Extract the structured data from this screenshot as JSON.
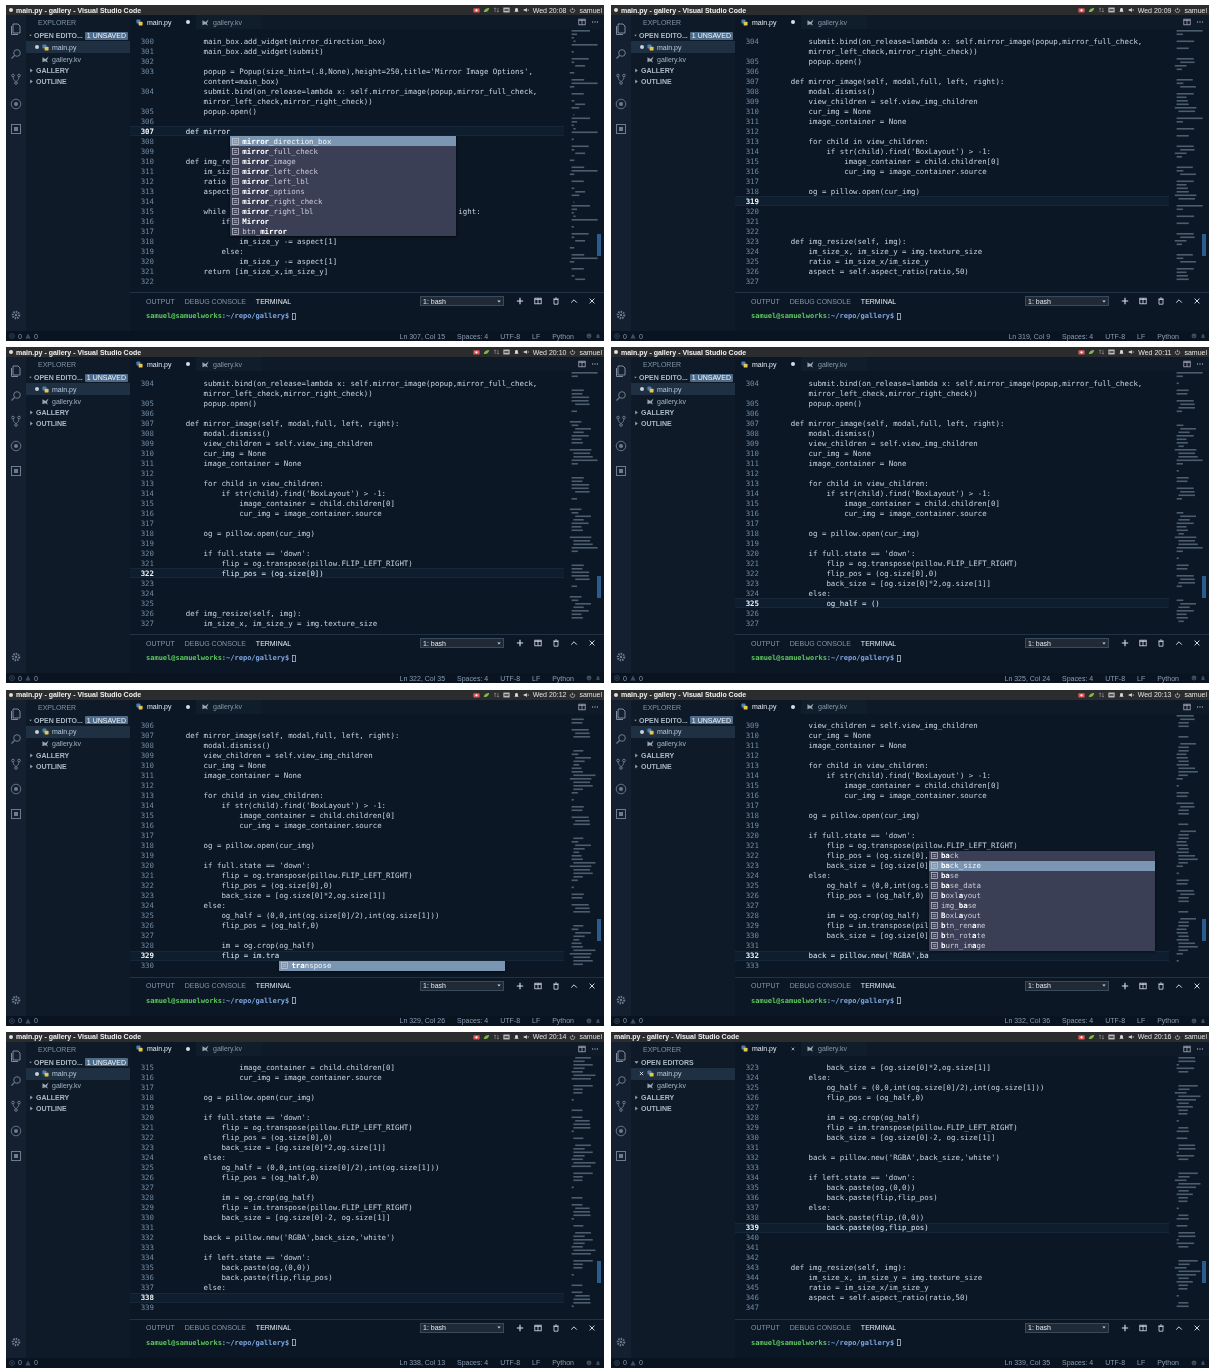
{
  "panels": [
    {
      "title": "main.py - gallery - Visual Studio Code",
      "unsaved": true,
      "clock": "Wed 20:08",
      "user": "samuel",
      "sidebar": {
        "header": "EXPLORER",
        "sections": [
          {
            "label": "OPEN EDITO...",
            "expanded": true,
            "badge": "1 UNSAVED",
            "files": [
              {
                "name": "main.py",
                "kind": "python",
                "selected": true,
                "unsaved": true
              },
              {
                "name": "gallery.kv",
                "kind": "kivy",
                "selected": false,
                "unsaved": false
              }
            ]
          },
          {
            "label": "GALLERY",
            "expanded": false
          },
          {
            "label": "OUTLINE",
            "expanded": false
          }
        ]
      },
      "tabs": [
        {
          "label": "main.py",
          "kind": "python",
          "selected": true,
          "unsaved": true
        },
        {
          "label": "gallery.kv",
          "kind": "kivy",
          "selected": false,
          "unsaved": false
        }
      ],
      "code": [
        {
          "n": "300",
          "text": "        main_box.add_widget(mirror_direction_box)",
          "current": false
        },
        {
          "n": "301",
          "text": "        main_box.add_widget(submit)",
          "current": false
        },
        {
          "n": "302",
          "current": false
        },
        {
          "n": "303",
          "text": "        popup = Popup(size_hint=(.8,None),height=250,title='Mirror Image Options',",
          "current": false
        },
        {
          "text": "        content=main_box)",
          "current": false
        },
        {
          "n": "304",
          "text": "        submit.bind(on_release=lambda x: self.mirror_image(popup,mirror_full_check,",
          "current": false
        },
        {
          "text": "        mirror_left_check,mirror_right_check))",
          "current": false
        },
        {
          "n": "305",
          "text": "        popup.open()",
          "current": false
        },
        {
          "n": "306",
          "current": false
        },
        {
          "n": "307",
          "text": "    def mirror",
          "current": true,
          "suggestions": [
            {
              "label": "**mirror**_direction_box",
              "selected": true
            },
            {
              "label": "**mirror**_full_check",
              "selected": false
            },
            {
              "label": "**mirror**_image",
              "selected": false
            },
            {
              "label": "**mirror**_left_check",
              "selected": false
            },
            {
              "label": "**mirror**_left_lbl",
              "selected": false
            },
            {
              "label": "**mirror**_options",
              "selected": false
            },
            {
              "label": "**mirror**_right_check",
              "selected": false
            },
            {
              "label": "**mirror**_right_lbl",
              "selected": false
            },
            {
              "label": "**Mirror**",
              "selected": false
            },
            {
              "label": "btn_**mirror**",
              "selected": false
            }
          ]
        },
        {
          "n": "308",
          "current": false
        },
        {
          "n": "309",
          "current": false
        },
        {
          "n": "310",
          "text": "    def img_re",
          "current": false
        },
        {
          "n": "311",
          "text": "        im_siz",
          "current": false
        },
        {
          "n": "312",
          "text": "        ratio",
          "current": false
        },
        {
          "n": "313",
          "text": "        aspect",
          "current": false
        },
        {
          "n": "314",
          "current": false
        },
        {
          "n": "315",
          "text": "        while",
          "tail": "ight:",
          "current": false
        },
        {
          "n": "316",
          "text": "            if",
          "current": false
        },
        {
          "n": "317",
          "current": false
        },
        {
          "n": "318",
          "text": "                im_size_y -= aspect[1]",
          "current": false
        },
        {
          "n": "319",
          "text": "            else:",
          "current": false
        },
        {
          "n": "320",
          "text": "                im_size_y -= aspect[1]",
          "current": false
        },
        {
          "n": "321",
          "text": "        return [im_size_x,im_size_y]",
          "current": false
        },
        {
          "n": "322",
          "current": false
        }
      ],
      "panel_tabs": [
        {
          "label": "OUTPUT",
          "selected": false
        },
        {
          "label": "DEBUG CONSOLE",
          "selected": false
        },
        {
          "label": "TERMINAL",
          "selected": true
        }
      ],
      "terminal_select": "1: bash",
      "prompt_user": "samuel@samuelworks",
      "prompt_path": ":~/repo/gallery$",
      "status": {
        "errors": "0",
        "warnings": "0",
        "items": [
          "Ln 307, Col 15",
          "Spaces: 4",
          "UTF-8",
          "LF",
          "Python"
        ]
      }
    },
    {
      "title": "main.py - gallery - Visual Studio Code",
      "unsaved": true,
      "clock": "Wed 20:09",
      "user": "samuel",
      "sidebar": {
        "header": "EXPLORER",
        "sections": [
          {
            "label": "OPEN EDITO...",
            "expanded": true,
            "badge": "1 UNSAVED",
            "files": [
              {
                "name": "main.py",
                "kind": "python",
                "selected": true,
                "unsaved": true
              },
              {
                "name": "gallery.kv",
                "kind": "kivy",
                "selected": false,
                "unsaved": false
              }
            ]
          },
          {
            "label": "GALLERY",
            "expanded": false
          },
          {
            "label": "OUTLINE",
            "expanded": false
          }
        ]
      },
      "tabs": [
        {
          "label": "main.py",
          "kind": "python",
          "selected": true,
          "unsaved": true
        },
        {
          "label": "gallery.kv",
          "kind": "kivy",
          "selected": false,
          "unsaved": false
        }
      ],
      "code": [
        {
          "n": "304",
          "text": "        submit.bind(on_release=lambda x: self.mirror_image(popup,mirror_full_check,",
          "current": false
        },
        {
          "text": "        mirror_left_check,mirror_right_check))",
          "current": false
        },
        {
          "n": "305",
          "text": "        popup.open()",
          "current": false
        },
        {
          "n": "306",
          "current": false
        },
        {
          "n": "307",
          "text": "    def mirror_image(self, modal,full, left, right):",
          "current": false
        },
        {
          "n": "308",
          "text": "        modal.dismiss()",
          "current": false
        },
        {
          "n": "309",
          "text": "        view_children = self.view_img_children",
          "current": false
        },
        {
          "n": "310",
          "text": "        cur_img = None",
          "current": false
        },
        {
          "n": "311",
          "text": "        image_container = None",
          "current": false
        },
        {
          "n": "312",
          "current": false
        },
        {
          "n": "313",
          "text": "        for child in view_children:",
          "current": false
        },
        {
          "n": "314",
          "text": "            if str(child).find('BoxLayout') > -1:",
          "current": false
        },
        {
          "n": "315",
          "text": "                image_container = child.children[0]",
          "current": false
        },
        {
          "n": "316",
          "text": "                cur_img = image_container.source",
          "current": false
        },
        {
          "n": "317",
          "current": false
        },
        {
          "n": "318",
          "text": "        og = pillow.open(cur_img)",
          "current": false
        },
        {
          "n": "319",
          "current": true
        },
        {
          "n": "320",
          "current": false
        },
        {
          "n": "321",
          "current": false
        },
        {
          "n": "322",
          "current": false
        },
        {
          "n": "323",
          "text": "    def img_resize(self, img):",
          "current": false
        },
        {
          "n": "324",
          "text": "        im_size_x, im_size_y = img.texture_size",
          "current": false
        },
        {
          "n": "325",
          "text": "        ratio = im_size_x/im_size_y",
          "current": false
        },
        {
          "n": "326",
          "text": "        aspect = self.aspect_ratio(ratio,50)",
          "current": false
        },
        {
          "n": "327",
          "current": false
        }
      ],
      "panel_tabs": [
        {
          "label": "OUTPUT",
          "selected": false
        },
        {
          "label": "DEBUG CONSOLE",
          "selected": false
        },
        {
          "label": "TERMINAL",
          "selected": true
        }
      ],
      "terminal_select": "1: bash",
      "prompt_user": "samuel@samuelworks",
      "prompt_path": ":~/repo/gallery$",
      "status": {
        "errors": "0",
        "warnings": "0",
        "items": [
          "Ln 319, Col 9",
          "Spaces: 4",
          "UTF-8",
          "LF",
          "Python"
        ]
      }
    },
    {
      "title": "main.py - gallery - Visual Studio Code",
      "unsaved": true,
      "clock": "Wed 20:10",
      "user": "samuel",
      "sidebar": {
        "header": "EXPLORER",
        "sections": [
          {
            "label": "OPEN EDITO...",
            "expanded": true,
            "badge": "1 UNSAVED",
            "files": [
              {
                "name": "main.py",
                "kind": "python",
                "selected": true,
                "unsaved": true
              },
              {
                "name": "gallery.kv",
                "kind": "kivy",
                "selected": false,
                "unsaved": false
              }
            ]
          },
          {
            "label": "GALLERY",
            "expanded": false
          },
          {
            "label": "OUTLINE",
            "expanded": false
          }
        ]
      },
      "tabs": [
        {
          "label": "main.py",
          "kind": "python",
          "selected": true,
          "unsaved": true
        },
        {
          "label": "gallery.kv",
          "kind": "kivy",
          "selected": false,
          "unsaved": false
        }
      ],
      "code": [
        {
          "n": "304",
          "text": "        submit.bind(on_release=lambda x: self.mirror_image(popup,mirror_full_check,",
          "current": false
        },
        {
          "text": "        mirror_left_check,mirror_right_check))",
          "current": false
        },
        {
          "n": "305",
          "text": "        popup.open()",
          "current": false
        },
        {
          "n": "306",
          "current": false
        },
        {
          "n": "307",
          "text": "    def mirror_image(self, modal,full, left, right):",
          "current": false
        },
        {
          "n": "308",
          "text": "        modal.dismiss()",
          "current": false
        },
        {
          "n": "309",
          "text": "        view_children = self.view_img_children",
          "current": false
        },
        {
          "n": "310",
          "text": "        cur_img = None",
          "current": false
        },
        {
          "n": "311",
          "text": "        image_container = None",
          "current": false
        },
        {
          "n": "312",
          "current": false
        },
        {
          "n": "313",
          "text": "        for child in view_children:",
          "current": false
        },
        {
          "n": "314",
          "text": "            if str(child).find('BoxLayout') > -1:",
          "current": false
        },
        {
          "n": "315",
          "text": "                image_container = child.children[0]",
          "current": false
        },
        {
          "n": "316",
          "text": "                cur_img = image_container.source",
          "current": false
        },
        {
          "n": "317",
          "current": false
        },
        {
          "n": "318",
          "text": "        og = pillow.open(cur_img)",
          "current": false
        },
        {
          "n": "319",
          "current": false
        },
        {
          "n": "320",
          "text": "        if full.state == 'down':",
          "current": false
        },
        {
          "n": "321",
          "text": "            flip = og.transpose(pillow.FLIP_LEFT_RIGHT)",
          "current": false
        },
        {
          "n": "322",
          "text": "            flip_pos = (og.size[0])",
          "current": true
        },
        {
          "n": "323",
          "current": false
        },
        {
          "n": "324",
          "current": false
        },
        {
          "n": "325",
          "current": false
        },
        {
          "n": "326",
          "text": "    def img_resize(self, img):",
          "current": false
        },
        {
          "n": "327",
          "text": "        im_size_x, im_size_y = img.texture_size",
          "current": false
        }
      ],
      "panel_tabs": [
        {
          "label": "OUTPUT",
          "selected": false
        },
        {
          "label": "DEBUG CONSOLE",
          "selected": false
        },
        {
          "label": "TERMINAL",
          "selected": true
        }
      ],
      "terminal_select": "1: bash",
      "prompt_user": "samuel@samuelworks",
      "prompt_path": ":~/repo/gallery$",
      "status": {
        "errors": "0",
        "warnings": "0",
        "items": [
          "Ln 322, Col 35",
          "Spaces: 4",
          "UTF-8",
          "LF",
          "Python"
        ]
      }
    },
    {
      "title": "main.py - gallery - Visual Studio Code",
      "unsaved": true,
      "clock": "Wed 20:11",
      "user": "samuel",
      "sidebar": {
        "header": "EXPLORER",
        "sections": [
          {
            "label": "OPEN EDITO...",
            "expanded": true,
            "badge": "1 UNSAVED",
            "files": [
              {
                "name": "main.py",
                "kind": "python",
                "selected": true,
                "unsaved": true
              },
              {
                "name": "gallery.kv",
                "kind": "kivy",
                "selected": false,
                "unsaved": false
              }
            ]
          },
          {
            "label": "GALLERY",
            "expanded": false
          },
          {
            "label": "OUTLINE",
            "expanded": false
          }
        ]
      },
      "tabs": [
        {
          "label": "main.py",
          "kind": "python",
          "selected": true,
          "unsaved": true
        },
        {
          "label": "gallery.kv",
          "kind": "kivy",
          "selected": false,
          "unsaved": false
        }
      ],
      "code": [
        {
          "n": "304",
          "text": "        submit.bind(on_release=lambda x: self.mirror_image(popup,mirror_full_check,",
          "current": false
        },
        {
          "text": "        mirror_left_check,mirror_right_check))",
          "current": false
        },
        {
          "n": "305",
          "text": "        popup.open()",
          "current": false
        },
        {
          "n": "306",
          "current": false
        },
        {
          "n": "307",
          "text": "    def mirror_image(self, modal,full, left, right):",
          "current": false
        },
        {
          "n": "308",
          "text": "        modal.dismiss()",
          "current": false
        },
        {
          "n": "309",
          "text": "        view_children = self.view_img_children",
          "current": false
        },
        {
          "n": "310",
          "text": "        cur_img = None",
          "current": false
        },
        {
          "n": "311",
          "text": "        image_container = None",
          "current": false
        },
        {
          "n": "312",
          "current": false
        },
        {
          "n": "313",
          "text": "        for child in view_children:",
          "current": false
        },
        {
          "n": "314",
          "text": "            if str(child).find('BoxLayout') > -1:",
          "current": false
        },
        {
          "n": "315",
          "text": "                image_container = child.children[0]",
          "current": false
        },
        {
          "n": "316",
          "text": "                cur_img = image_container.source",
          "current": false
        },
        {
          "n": "317",
          "current": false
        },
        {
          "n": "318",
          "text": "        og = pillow.open(cur_img)",
          "current": false
        },
        {
          "n": "319",
          "current": false
        },
        {
          "n": "320",
          "text": "        if full.state == 'down':",
          "current": false
        },
        {
          "n": "321",
          "text": "            flip = og.transpose(pillow.FLIP_LEFT_RIGHT)",
          "current": false
        },
        {
          "n": "322",
          "text": "            flip_pos = (og.size[0],0)",
          "current": false
        },
        {
          "n": "323",
          "text": "            back_size = [og.size[0]*2,og.size[1]]",
          "current": false
        },
        {
          "n": "324",
          "text": "        else:",
          "current": false
        },
        {
          "n": "325",
          "text": "            og_half = ()",
          "current": true
        },
        {
          "n": "326",
          "current": false
        },
        {
          "n": "327",
          "current": false
        }
      ],
      "panel_tabs": [
        {
          "label": "OUTPUT",
          "selected": false
        },
        {
          "label": "DEBUG CONSOLE",
          "selected": false
        },
        {
          "label": "TERMINAL",
          "selected": true
        }
      ],
      "terminal_select": "1: bash",
      "prompt_user": "samuel@samuelworks",
      "prompt_path": ":~/repo/gallery$",
      "status": {
        "errors": "0",
        "warnings": "0",
        "items": [
          "Ln 325, Col 24",
          "Spaces: 4",
          "UTF-8",
          "LF",
          "Python"
        ]
      }
    },
    {
      "title": "main.py - gallery - Visual Studio Code",
      "unsaved": true,
      "clock": "Wed 20:12",
      "user": "samuel",
      "sidebar": {
        "header": "EXPLORER",
        "sections": [
          {
            "label": "OPEN EDITO...",
            "expanded": true,
            "badge": "1 UNSAVED",
            "files": [
              {
                "name": "main.py",
                "kind": "python",
                "selected": true,
                "unsaved": true
              },
              {
                "name": "gallery.kv",
                "kind": "kivy",
                "selected": false,
                "unsaved": false
              }
            ]
          },
          {
            "label": "GALLERY",
            "expanded": false
          },
          {
            "label": "OUTLINE",
            "expanded": false
          }
        ]
      },
      "tabs": [
        {
          "label": "main.py",
          "kind": "python",
          "selected": true,
          "unsaved": true
        },
        {
          "label": "gallery.kv",
          "kind": "kivy",
          "selected": false,
          "unsaved": false
        }
      ],
      "code": [
        {
          "n": "306",
          "current": false
        },
        {
          "n": "307",
          "text": "    def mirror_image(self, modal,full, left, right):",
          "current": false
        },
        {
          "n": "308",
          "text": "        modal.dismiss()",
          "current": false
        },
        {
          "n": "309",
          "text": "        view_children = self.view_img_children",
          "current": false
        },
        {
          "n": "310",
          "text": "        cur_img = None",
          "current": false
        },
        {
          "n": "311",
          "text": "        image_container = None",
          "current": false
        },
        {
          "n": "312",
          "current": false
        },
        {
          "n": "313",
          "text": "        for child in view_children:",
          "current": false
        },
        {
          "n": "314",
          "text": "            if str(child).find('BoxLayout') > -1:",
          "current": false
        },
        {
          "n": "315",
          "text": "                image_container = child.children[0]",
          "current": false
        },
        {
          "n": "316",
          "text": "                cur_img = image_container.source",
          "current": false
        },
        {
          "n": "317",
          "current": false
        },
        {
          "n": "318",
          "text": "        og = pillow.open(cur_img)",
          "current": false
        },
        {
          "n": "319",
          "current": false
        },
        {
          "n": "320",
          "text": "        if full.state == 'down':",
          "current": false
        },
        {
          "n": "321",
          "text": "            flip = og.transpose(pillow.FLIP_LEFT_RIGHT)",
          "current": false
        },
        {
          "n": "322",
          "text": "            flip_pos = (og.size[0],0)",
          "current": false
        },
        {
          "n": "323",
          "text": "            back_size = [og.size[0]*2,og.size[1]]",
          "current": false
        },
        {
          "n": "324",
          "text": "        else:",
          "current": false
        },
        {
          "n": "325",
          "text": "            og_half = (0,0,int(og.size[0]/2),int(og.size[1]))",
          "current": false
        },
        {
          "n": "326",
          "text": "            flip_pos = (og_half,0)",
          "current": false
        },
        {
          "n": "327",
          "current": false
        },
        {
          "n": "328",
          "text": "            im = og.crop(og_half)",
          "current": false
        },
        {
          "n": "329",
          "text": "            flip = im.tra",
          "current": true,
          "suggestions": [
            {
              "label": "**tra**nspose",
              "selected": true
            }
          ]
        },
        {
          "n": "330",
          "current": false
        }
      ],
      "panel_tabs": [
        {
          "label": "OUTPUT",
          "selected": false
        },
        {
          "label": "DEBUG CONSOLE",
          "selected": false
        },
        {
          "label": "TERMINAL",
          "selected": true
        }
      ],
      "terminal_select": "1: bash",
      "prompt_user": "samuel@samuelworks",
      "prompt_path": ":~/repo/gallery$",
      "status": {
        "errors": "0",
        "warnings": "0",
        "items": [
          "Ln 329, Col 26",
          "Spaces: 4",
          "UTF-8",
          "LF",
          "Python"
        ]
      }
    },
    {
      "title": "main.py - gallery - Visual Studio Code",
      "unsaved": true,
      "clock": "Wed 20:13",
      "user": "samuel",
      "sidebar": {
        "header": "EXPLORER",
        "sections": [
          {
            "label": "OPEN EDITO...",
            "expanded": true,
            "badge": "1 UNSAVED",
            "files": [
              {
                "name": "main.py",
                "kind": "python",
                "selected": true,
                "unsaved": true
              },
              {
                "name": "gallery.kv",
                "kind": "kivy",
                "selected": false,
                "unsaved": false
              }
            ]
          },
          {
            "label": "GALLERY",
            "expanded": false
          },
          {
            "label": "OUTLINE",
            "expanded": false
          }
        ]
      },
      "tabs": [
        {
          "label": "main.py",
          "kind": "python",
          "selected": true,
          "unsaved": true
        },
        {
          "label": "gallery.kv",
          "kind": "kivy",
          "selected": false,
          "unsaved": false
        }
      ],
      "code": [
        {
          "n": "309",
          "text": "        view_children = self.view_img_children",
          "current": false
        },
        {
          "n": "310",
          "text": "        cur_img = None",
          "current": false
        },
        {
          "n": "311",
          "text": "        image_container = None",
          "current": false
        },
        {
          "n": "312",
          "current": false
        },
        {
          "n": "313",
          "text": "        for child in view_children:",
          "current": false
        },
        {
          "n": "314",
          "text": "            if str(child).find('BoxLayout') > -1:",
          "current": false
        },
        {
          "n": "315",
          "text": "                image_container = child.children[0]",
          "current": false
        },
        {
          "n": "316",
          "text": "                cur_img = image_container.source",
          "current": false
        },
        {
          "n": "317",
          "current": false
        },
        {
          "n": "318",
          "text": "        og = pillow.open(cur_img)",
          "current": false
        },
        {
          "n": "319",
          "current": false
        },
        {
          "n": "320",
          "text": "        if full.state == 'down':",
          "current": false
        },
        {
          "n": "321",
          "text": "            flip = og.transpose(pillow.FLIP_LEFT_RIGHT)",
          "current": false
        },
        {
          "n": "322",
          "text": "            flip_pos = (og.size[0],",
          "current": false
        },
        {
          "n": "323",
          "text": "            back_size = [og.size[0]",
          "current": false
        },
        {
          "n": "324",
          "text": "        else:",
          "current": false
        },
        {
          "n": "325",
          "text": "            og_half = (0,0,int(og.s",
          "current": false
        },
        {
          "n": "326",
          "text": "            flip_pos = (og_half,0)",
          "current": false
        },
        {
          "n": "327",
          "current": false
        },
        {
          "n": "328",
          "text": "            im = og.crop(og_half)",
          "current": false
        },
        {
          "n": "329",
          "text": "            flip = im.transpose(pil",
          "current": false
        },
        {
          "n": "330",
          "text": "            back_size = [og.size[0]",
          "current": false
        },
        {
          "n": "331",
          "current": false
        },
        {
          "n": "332",
          "text": "        back = pillow.new('RGBA',ba",
          "current": true,
          "suggestions": [
            {
              "label": "**ba**ck",
              "selected": false
            },
            {
              "label": "**ba**ck_size",
              "selected": true
            },
            {
              "label": "**ba**se",
              "selected": false
            },
            {
              "label": "**ba**se_data",
              "selected": false
            },
            {
              "label": "**b**oxl**a**yout",
              "selected": false
            },
            {
              "label": "img_**ba**se",
              "selected": false
            },
            {
              "label": "**B**oxL**a**yout",
              "selected": false
            },
            {
              "label": "**b**tn_ren**a**me",
              "selected": false
            },
            {
              "label": "**b**tn_rot**a**te",
              "selected": false
            },
            {
              "label": "**b**urn_im**a**ge",
              "selected": false
            }
          ]
        },
        {
          "n": "333",
          "current": false
        }
      ],
      "panel_tabs": [
        {
          "label": "OUTPUT",
          "selected": false
        },
        {
          "label": "DEBUG CONSOLE",
          "selected": false
        },
        {
          "label": "TERMINAL",
          "selected": true
        }
      ],
      "terminal_select": "1: bash",
      "prompt_user": "samuel@samuelworks",
      "prompt_path": ":~/repo/gallery$",
      "status": {
        "errors": "0",
        "warnings": "0",
        "items": [
          "Ln 332, Col 36",
          "Spaces: 4",
          "UTF-8",
          "LF",
          "Python"
        ]
      }
    },
    {
      "title": "main.py - gallery - Visual Studio Code",
      "unsaved": true,
      "clock": "Wed 20:14",
      "user": "samuel",
      "sidebar": {
        "header": "EXPLORER",
        "sections": [
          {
            "label": "OPEN EDITO...",
            "expanded": true,
            "badge": "1 UNSAVED",
            "files": [
              {
                "name": "main.py",
                "kind": "python",
                "selected": true,
                "unsaved": true
              },
              {
                "name": "gallery.kv",
                "kind": "kivy",
                "selected": false,
                "unsaved": false
              }
            ]
          },
          {
            "label": "GALLERY",
            "expanded": false
          },
          {
            "label": "OUTLINE",
            "expanded": false
          }
        ]
      },
      "tabs": [
        {
          "label": "main.py",
          "kind": "python",
          "selected": true,
          "unsaved": true
        },
        {
          "label": "gallery.kv",
          "kind": "kivy",
          "selected": false,
          "unsaved": false
        }
      ],
      "code": [
        {
          "n": "315",
          "text": "                image_container = child.children[0]",
          "current": false
        },
        {
          "n": "316",
          "text": "                cur_img = image_container.source",
          "current": false
        },
        {
          "n": "317",
          "current": false
        },
        {
          "n": "318",
          "text": "        og = pillow.open(cur_img)",
          "current": false
        },
        {
          "n": "319",
          "current": false
        },
        {
          "n": "320",
          "text": "        if full.state == 'down':",
          "current": false
        },
        {
          "n": "321",
          "text": "            flip = og.transpose(pillow.FLIP_LEFT_RIGHT)",
          "current": false
        },
        {
          "n": "322",
          "text": "            flip_pos = (og.size[0],0)",
          "current": false
        },
        {
          "n": "323",
          "text": "            back_size = [og.size[0]*2,og.size[1]]",
          "current": false
        },
        {
          "n": "324",
          "text": "        else:",
          "current": false
        },
        {
          "n": "325",
          "text": "            og_half = (0,0,int(og.size[0]/2),int(og.size[1]))",
          "current": false
        },
        {
          "n": "326",
          "text": "            flip_pos = (og_half,0)",
          "current": false
        },
        {
          "n": "327",
          "current": false
        },
        {
          "n": "328",
          "text": "            im = og.crop(og_half)",
          "current": false
        },
        {
          "n": "329",
          "text": "            flip = im.transpose(pillow.FLIP_LEFT_RIGHT)",
          "current": false
        },
        {
          "n": "330",
          "text": "            back_size = [og.size[0]-2, og.size[1]]",
          "current": false
        },
        {
          "n": "331",
          "current": false
        },
        {
          "n": "332",
          "text": "        back = pillow.new('RGBA',back_size,'white')",
          "current": false
        },
        {
          "n": "333",
          "current": false
        },
        {
          "n": "334",
          "text": "        if left.state == 'down':",
          "current": false
        },
        {
          "n": "335",
          "text": "            back.paste(og,(0,0))",
          "current": false
        },
        {
          "n": "336",
          "text": "            back.paste(flip,flip_pos)",
          "current": false
        },
        {
          "n": "337",
          "text": "        else:",
          "current": false
        },
        {
          "n": "338",
          "current": true
        },
        {
          "n": "339",
          "current": false
        }
      ],
      "panel_tabs": [
        {
          "label": "OUTPUT",
          "selected": false
        },
        {
          "label": "DEBUG CONSOLE",
          "selected": false
        },
        {
          "label": "TERMINAL",
          "selected": true
        }
      ],
      "terminal_select": "1: bash",
      "prompt_user": "samuel@samuelworks",
      "prompt_path": ":~/repo/gallery$",
      "status": {
        "errors": "0",
        "warnings": "0",
        "items": [
          "Ln 338, Col 13",
          "Spaces: 4",
          "UTF-8",
          "LF",
          "Python"
        ]
      }
    },
    {
      "title": "main.py - gallery - Visual Studio Code",
      "unsaved": false,
      "clock": "Wed 20:16",
      "user": "samuel",
      "sidebar": {
        "header": "EXPLORER",
        "sections": [
          {
            "label": "OPEN EDITORS",
            "expanded": true,
            "files": [
              {
                "name": "main.py",
                "kind": "python",
                "selected": true,
                "unsaved": false
              },
              {
                "name": "gallery.kv",
                "kind": "kivy",
                "selected": false,
                "unsaved": false
              }
            ]
          },
          {
            "label": "GALLERY",
            "expanded": false
          },
          {
            "label": "OUTLINE",
            "expanded": false
          }
        ]
      },
      "tabs": [
        {
          "label": "main.py",
          "kind": "python",
          "selected": true,
          "unsaved": false
        },
        {
          "label": "gallery.kv",
          "kind": "kivy",
          "selected": false,
          "unsaved": false
        }
      ],
      "code": [
        {
          "n": "323",
          "text": "            back_size = [og.size[0]*2,og.size[1]]",
          "current": false
        },
        {
          "n": "324",
          "text": "        else:",
          "current": false
        },
        {
          "n": "325",
          "text": "            og_half = (0,0,int(og.size[0]/2),int(og.size[1]))",
          "current": false
        },
        {
          "n": "326",
          "text": "            flip_pos = (og_half,0)",
          "current": false
        },
        {
          "n": "327",
          "current": false
        },
        {
          "n": "328",
          "text": "            im = og.crop(og_half)",
          "current": false
        },
        {
          "n": "329",
          "text": "            flip = im.transpose(pillow.FLIP_LEFT_RIGHT)",
          "current": false
        },
        {
          "n": "330",
          "text": "            back_size = [og.size[0]-2, og.size[1]]",
          "current": false
        },
        {
          "n": "331",
          "current": false
        },
        {
          "n": "332",
          "text": "        back = pillow.new('RGBA',back_size,'white')",
          "current": false
        },
        {
          "n": "333",
          "current": false
        },
        {
          "n": "334",
          "text": "        if left.state == 'down':",
          "current": false
        },
        {
          "n": "335",
          "text": "            back.paste(og,(0,0))",
          "current": false
        },
        {
          "n": "336",
          "text": "            back.paste(flip,flip_pos)",
          "current": false
        },
        {
          "n": "337",
          "text": "        else:",
          "current": false
        },
        {
          "n": "338",
          "text": "            back.paste(flip,(0,0))",
          "current": false
        },
        {
          "n": "339",
          "text": "            back.paste(og,flip_pos)",
          "current": true
        },
        {
          "n": "340",
          "current": false
        },
        {
          "n": "341",
          "current": false
        },
        {
          "n": "342",
          "current": false
        },
        {
          "n": "343",
          "text": "    def img_resize(self, img):",
          "current": false
        },
        {
          "n": "344",
          "text": "        im_size_x, im_size_y = img.texture_size",
          "current": false
        },
        {
          "n": "345",
          "text": "        ratio = im_size_x/im_size_y",
          "current": false
        },
        {
          "n": "346",
          "text": "        aspect = self.aspect_ratio(ratio,50)",
          "current": false
        },
        {
          "n": "347",
          "current": false
        }
      ],
      "panel_tabs": [
        {
          "label": "OUTPUT",
          "selected": false
        },
        {
          "label": "DEBUG CONSOLE",
          "selected": false
        },
        {
          "label": "TERMINAL",
          "selected": true
        }
      ],
      "terminal_select": "1: bash",
      "prompt_user": "samuel@samuelworks",
      "prompt_path": ":~/repo/gallery$",
      "status": {
        "errors": "0",
        "warnings": "0",
        "items": [
          "Ln 339, Col 35",
          "Spaces: 4",
          "UTF-8",
          "LF",
          "Python"
        ]
      }
    }
  ]
}
